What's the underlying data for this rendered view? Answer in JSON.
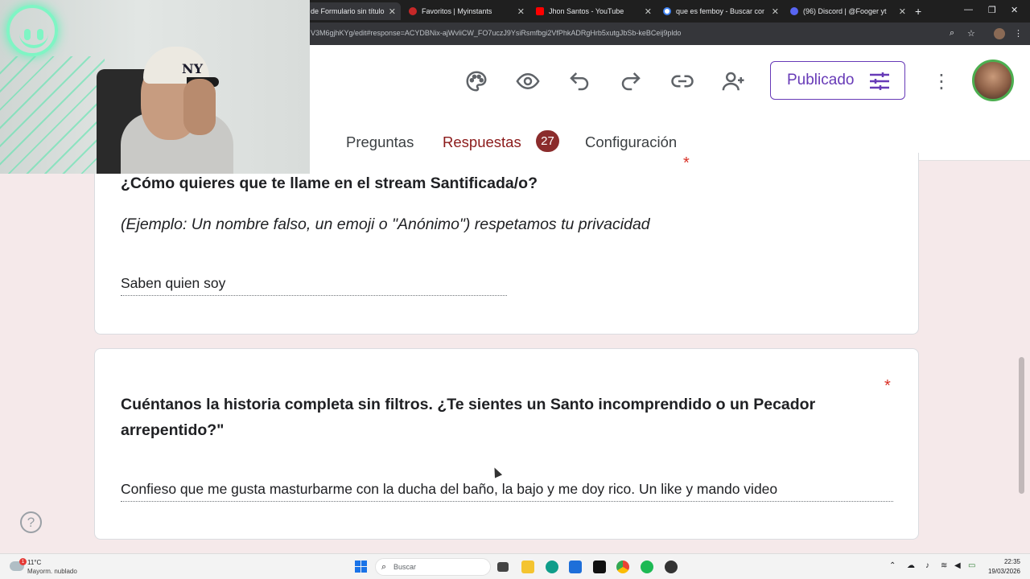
{
  "browser": {
    "tabs": [
      {
        "label": "de Formulario sin título",
        "active": true,
        "favicon_color": "#673ab7"
      },
      {
        "label": "Favoritos | Myinstants",
        "active": false,
        "favicon_color": "#c62828"
      },
      {
        "label": "Jhon Santos - YouTube",
        "active": false,
        "favicon_color": "#ff0000"
      },
      {
        "label": "que es femboy - Buscar con Go",
        "active": false,
        "favicon_color": "#4285f4"
      },
      {
        "label": "(96) Discord | @Fooger yt",
        "active": false,
        "favicon_color": "#5865f2"
      }
    ],
    "url": "V3M6gjhKYg/edit#response=ACYDBNix-ajWvliCW_FO7uczJ9YsiRsmfbgi2VfPhkADRgHrb5xutgJbSb-keBCeij9pldo"
  },
  "header": {
    "publish_label": "Publicado",
    "tabs": [
      {
        "label": "Preguntas"
      },
      {
        "label": "Respuestas",
        "badge": "27",
        "active": true
      },
      {
        "label": "Configuración"
      }
    ]
  },
  "questions": [
    {
      "title": "¿Cómo quieres que te llame en el stream Santificada/o?",
      "description": "(Ejemplo: Un nombre falso, un emoji o \"Anónimo\") respetamos tu privacidad",
      "answer": "Saben quien soy",
      "required_mark": "*"
    },
    {
      "title_line1": "Cuéntanos la historia completa sin filtros. ¿Te sientes un Santo incomprendido o un Pecador",
      "title_line2": "arrepentido?\"",
      "answer": "Confieso que me gusta masturbarme con la ducha del baño, la bajo y me doy rico. Un like y mando video",
      "required_mark": "*"
    }
  ],
  "help_label": "?",
  "taskbar": {
    "weather_temp": "11°C",
    "weather_condition": "Mayorm. nublado",
    "weather_badge": "1",
    "search_placeholder": "Buscar",
    "time": "22:35",
    "date": "19/03/2026"
  },
  "colors": {
    "accent": "#673ab7",
    "responses_accent": "#8b2c2c",
    "required": "#d93025",
    "page_background": "#f5e9ea"
  }
}
